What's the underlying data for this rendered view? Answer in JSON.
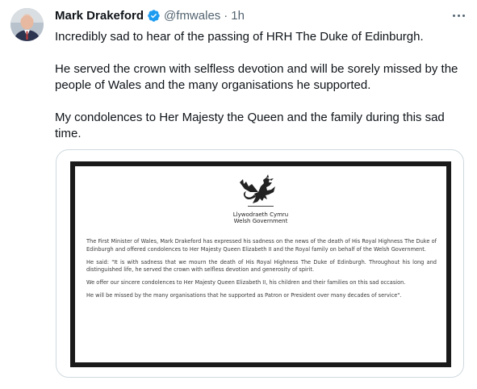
{
  "author": {
    "name": "Mark Drakeford",
    "handle": "@fmwales",
    "separator": "·",
    "time": "1h",
    "avatar_icon": "profile-photo",
    "verified_icon": "verified-badge-icon",
    "verified_color": "#1d9bf0"
  },
  "tweet": {
    "paragraphs": [
      "Incredibly sad to hear of the passing of HRH The Duke of Edinburgh.",
      "He served the crown with selfless devotion and will be sorely missed by the people of Wales and the many organisations he supported.",
      "My condolences to Her Majesty the Queen and the family during this sad time."
    ]
  },
  "image": {
    "logo": "welsh-dragon-logo",
    "gov_name_cy": "Llywodraeth Cymru",
    "gov_name_en": "Welsh Government",
    "statement": [
      "The First Minister of Wales, Mark Drakeford has expressed his sadness on the news of the death of His Royal Highness The Duke of Edinburgh and offered condolences to Her Majesty Queen Elizabeth II and the Royal family on behalf of the Welsh Government.",
      "He said: \"It is with sadness that we mourn the death of His Royal Highness The Duke of Edinburgh. Throughout his long and distinguished life, he served the crown with selfless devotion and generosity of spirit.",
      "We offer our sincere condolences to Her Majesty Queen Elizabeth II, his children and their families on this sad occasion.",
      "He will be missed by the many organisations that he supported as Patron or President over many decades of service\"."
    ]
  },
  "icons": {
    "more": "more-options-icon"
  }
}
